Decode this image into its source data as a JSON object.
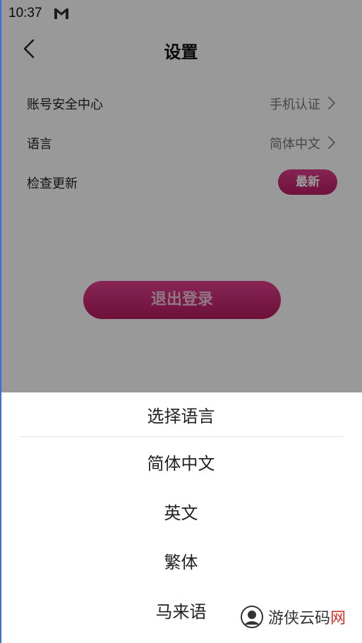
{
  "status_bar": {
    "time": "10:37"
  },
  "header": {
    "title": "设置"
  },
  "settings": {
    "rows": [
      {
        "label": "账号安全中心",
        "value": "手机认证"
      },
      {
        "label": "语言",
        "value": "简体中文"
      },
      {
        "label": "检查更新",
        "badge": "最新"
      }
    ]
  },
  "logout_label": "退出登录",
  "language_sheet": {
    "title": "选择语言",
    "options": [
      "简体中文",
      "英文",
      "繁体",
      "马来语"
    ]
  },
  "watermark": {
    "text_main": "游侠云码",
    "text_highlight": "网"
  },
  "colors": {
    "accent": "#c8246f",
    "overlay": "rgba(0,0,0,0.40)",
    "edge": "#3a6fd8"
  }
}
